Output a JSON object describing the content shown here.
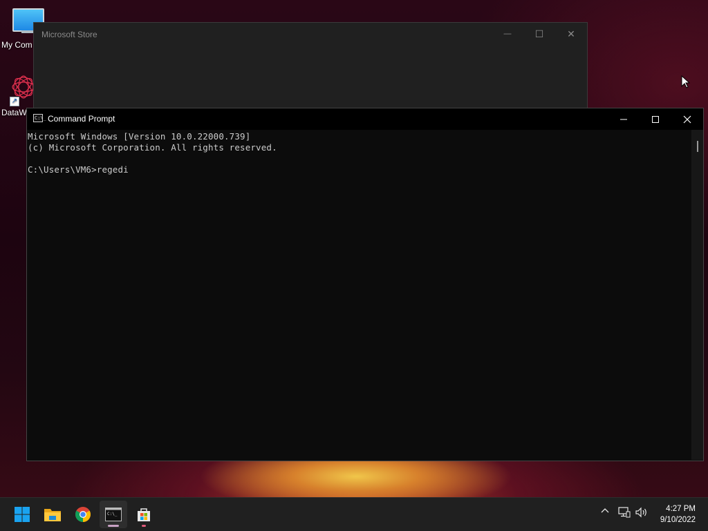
{
  "desktop": {
    "icons": [
      {
        "label": "My Com"
      },
      {
        "label": "DataW"
      }
    ]
  },
  "store_window": {
    "title": "Microsoft Store",
    "controls": {
      "minimize": "—",
      "maximize": "☐",
      "close": "✕"
    }
  },
  "cmd_window": {
    "title": "Command Prompt",
    "icon_text": "C:\\_",
    "lines": [
      "Microsoft Windows [Version 10.0.22000.739]",
      "(c) Microsoft Corporation. All rights reserved.",
      "",
      "C:\\Users\\VM6>regedi"
    ]
  },
  "taskbar": {
    "apps": [
      {
        "name": "start",
        "icon": "windows-logo-icon"
      },
      {
        "name": "file-explorer",
        "icon": "folder-icon"
      },
      {
        "name": "chrome",
        "icon": "chrome-icon"
      },
      {
        "name": "command-prompt",
        "icon": "terminal-icon",
        "active": true
      },
      {
        "name": "microsoft-store",
        "icon": "store-icon"
      }
    ],
    "tray": {
      "chevron": "^",
      "time": "4:27 PM",
      "date": "9/10/2022"
    }
  },
  "colors": {
    "cmd_text": "#cccccc",
    "cmd_bg": "#0c0c0c",
    "taskbar_bg": "#202020",
    "accent": "#0078d4"
  }
}
